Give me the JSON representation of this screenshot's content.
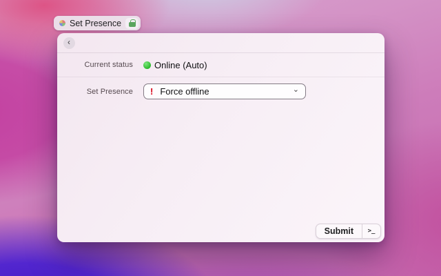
{
  "tab": {
    "label": "Set Presence"
  },
  "header": {
    "back_glyph": "‹"
  },
  "status_row": {
    "label": "Current status",
    "value": "Online (Auto)"
  },
  "presence_row": {
    "label": "Set Presence",
    "warning_glyph": "!",
    "selected_option": "Force offline",
    "chevron_glyph": "⌄"
  },
  "footer": {
    "submit_label": "Submit",
    "terminal_glyph": ">_"
  },
  "colors": {
    "status_green": "#2db92d",
    "warning_red": "#d70015"
  }
}
